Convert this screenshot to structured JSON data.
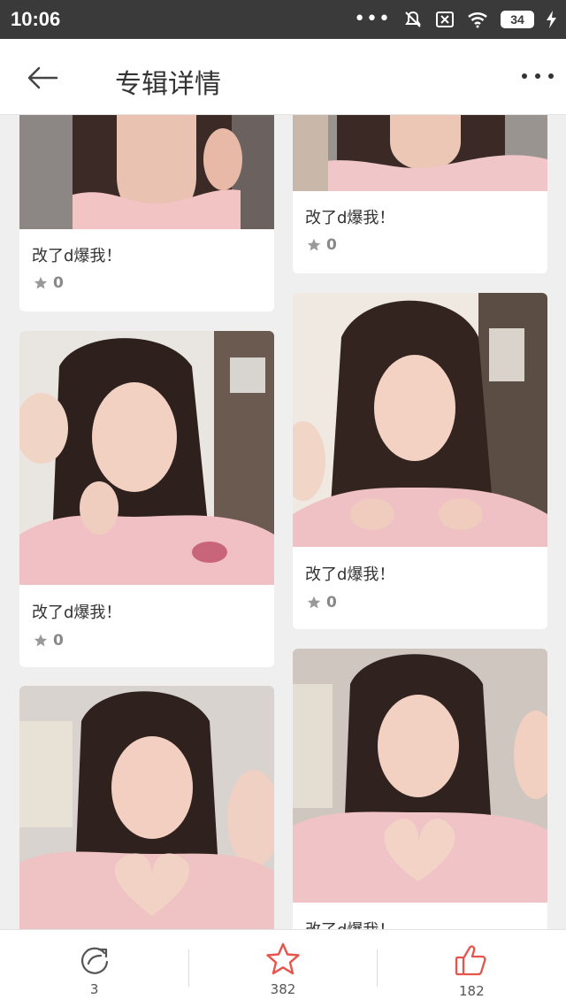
{
  "status_bar": {
    "time": "10:06",
    "battery": "34"
  },
  "header": {
    "title": "专辑详情"
  },
  "cards": [
    {
      "caption": "改了d爆我！",
      "stars": "0"
    },
    {
      "caption": "改了d爆我！",
      "stars": "0"
    },
    {
      "caption": "改了d爆我！",
      "stars": "0"
    },
    {
      "caption": "改了d爆我！",
      "stars": "0"
    },
    {
      "caption": "改了d爆我！"
    }
  ],
  "bottom_bar": {
    "share_count": "3",
    "favorite_count": "382",
    "like_count": "182"
  },
  "colors": {
    "accent": "#e8534a",
    "status_bar": "#3a3a3a"
  }
}
